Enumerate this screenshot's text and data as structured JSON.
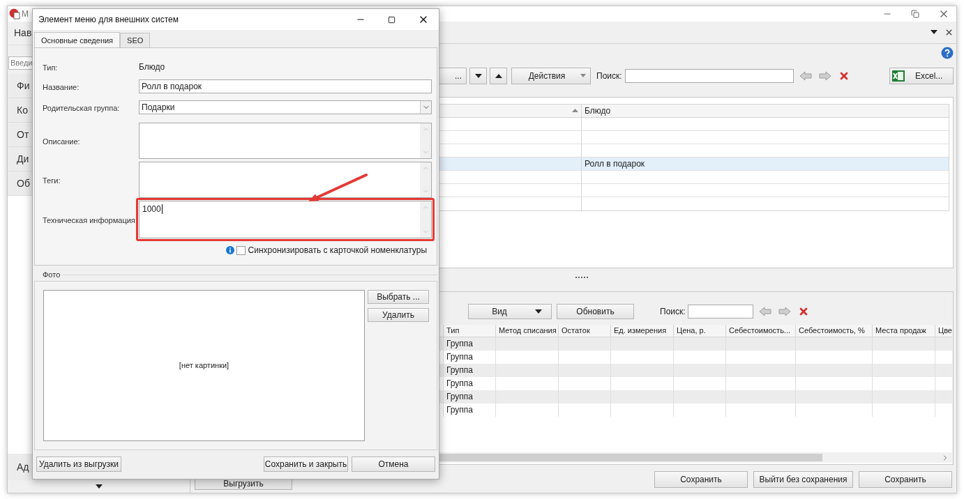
{
  "main_window": {
    "title": "М",
    "nav_panel": {
      "title": "Нав",
      "search": {
        "placeholder": "Введи"
      },
      "items": [
        {
          "label": "Фи"
        },
        {
          "label": "Ко"
        },
        {
          "label": "От"
        },
        {
          "label": "Ди"
        },
        {
          "label": "Об"
        }
      ],
      "bottom_item": {
        "label": "Ад"
      }
    },
    "toolbar": {
      "partial_button": "...",
      "actions_button": "Действия",
      "search_label": "Поиск:",
      "excel_button": "Excel..."
    },
    "top_table": {
      "column_2": "Блюдо",
      "rows": [
        {
          "selected": false
        },
        {
          "selected": false
        },
        {
          "selected": false
        },
        {
          "selected": true,
          "column_2": "Ролл в подарок"
        },
        {
          "selected": false
        },
        {
          "selected": false
        },
        {
          "selected": false
        }
      ]
    },
    "bottom_panel": {
      "view_button": "Вид",
      "refresh_button": "Обновить",
      "search_label": "Поиск:",
      "columns": [
        "Тип",
        "Метод списания",
        "Остаток",
        "Ед. измерения",
        "Цена, р.",
        "Себестоимость...",
        "Себестоимость, %",
        "Места продаж",
        "Цве"
      ],
      "rows": [
        {
          "type": "Группа"
        },
        {
          "type": "Группа"
        },
        {
          "type": "Группа"
        },
        {
          "type": "Группа"
        },
        {
          "type": "Группа"
        },
        {
          "type": "Группа"
        }
      ]
    },
    "buttons": [
      "Выгрузить",
      "Сохранить",
      "Выйти без сохранения",
      "Сохранить"
    ]
  },
  "dialog": {
    "title": "Элемент меню для внешних систем",
    "tabs": [
      {
        "label": "Основные сведения",
        "selected": true
      },
      {
        "label": "SEO",
        "selected": false
      }
    ],
    "fields": [
      {
        "kind": "text",
        "label": "Тип:",
        "value": "Блюдо"
      },
      {
        "kind": "input",
        "label": "Название:",
        "value": "Ролл в подарок"
      },
      {
        "kind": "select",
        "label": "Родительская группа:",
        "value": "Подарки"
      },
      {
        "kind": "textarea",
        "label": "Описание:",
        "highlighted": false
      },
      {
        "kind": "textarea",
        "label": "Теги:",
        "highlighted": false
      },
      {
        "kind": "textarea",
        "label": "Техническая информация:",
        "value": "1000",
        "highlighted": true
      }
    ],
    "sync_checkbox": {
      "label": "Синхронизировать с карточкой номенклатуры",
      "checked": false
    },
    "photo": {
      "title": "Фото",
      "empty_text": "[нет картинки]",
      "buttons": [
        "Выбрать ...",
        "Удалить"
      ]
    },
    "footer": {
      "left_button": "Удалить из выгрузки",
      "buttons": [
        "Сохранить и закрыть",
        "Отмена"
      ]
    }
  }
}
